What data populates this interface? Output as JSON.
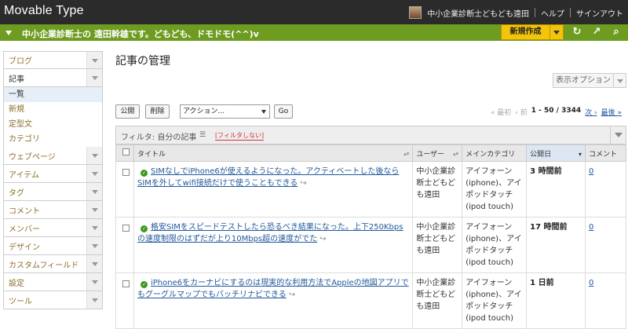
{
  "app": {
    "logo": "Movable Type"
  },
  "top_nav": {
    "user": "中小企業診断士どもども遠田",
    "help": "ヘルプ",
    "signout": "サインアウト"
  },
  "blogbar": {
    "name": "中小企業診断士の 遠田幹雄です。どもども、ドモドモ(^^)v",
    "new_label": "新規作成"
  },
  "sidebar": {
    "items": [
      {
        "label": "ブログ"
      },
      {
        "label": "記事"
      },
      {
        "label": "ウェブページ"
      },
      {
        "label": "アイテム"
      },
      {
        "label": "タグ"
      },
      {
        "label": "コメント"
      },
      {
        "label": "メンバー"
      },
      {
        "label": "デザイン"
      },
      {
        "label": "カスタムフィールド"
      },
      {
        "label": "設定"
      },
      {
        "label": "ツール"
      }
    ],
    "sub": [
      "一覧",
      "新規",
      "定型文",
      "カテゴリ"
    ]
  },
  "main": {
    "title": "記事の管理",
    "display_options": "表示オプション",
    "publish": "公開",
    "delete": "削除",
    "action": "アクション...",
    "go": "Go",
    "pager": {
      "first": "« 最初",
      "prev": "‹ 前",
      "range": "1 - 50 / 3344",
      "next": "次 ›",
      "last": "最後 »"
    },
    "filter": {
      "label": "フィルタ: 自分の記事",
      "remove": "[フィルタしない]"
    }
  },
  "table": {
    "headers": {
      "title": "タイトル",
      "user": "ユーザー",
      "category": "メインカテゴリ",
      "date": "公開日",
      "comment": "コメント"
    },
    "rows": [
      {
        "title": "SIMなしでiPhone6が使えるようになった。アクティベートした後ならSIMを外してwifi接続だけで使うこともできる",
        "user": "中小企業診断士どもども遠田",
        "category": "アイフォーン(iphone)、アイポッドタッチ(ipod touch)",
        "date": "3 時間前",
        "comments": "0"
      },
      {
        "title": "格安SIMをスピードテストしたら恐るべき結果になった。上下250Kbpsの速度制限のはずだが上り10Mbps超の速度がでた",
        "user": "中小企業診断士どもども遠田",
        "category": "アイフォーン(iphone)、アイポッドタッチ(ipod touch)",
        "date": "17 時間前",
        "comments": "0"
      },
      {
        "title": "iPhone6をカーナビにするのは現実的な利用方法でAppleの地図アプリでもグーグルマップでもバッチリナビできる",
        "user": "中小企業診断士どもども遠田",
        "category": "アイフォーン(iphone)、アイポッドタッチ(ipod touch)",
        "date": "1 日前",
        "comments": "0"
      }
    ]
  }
}
